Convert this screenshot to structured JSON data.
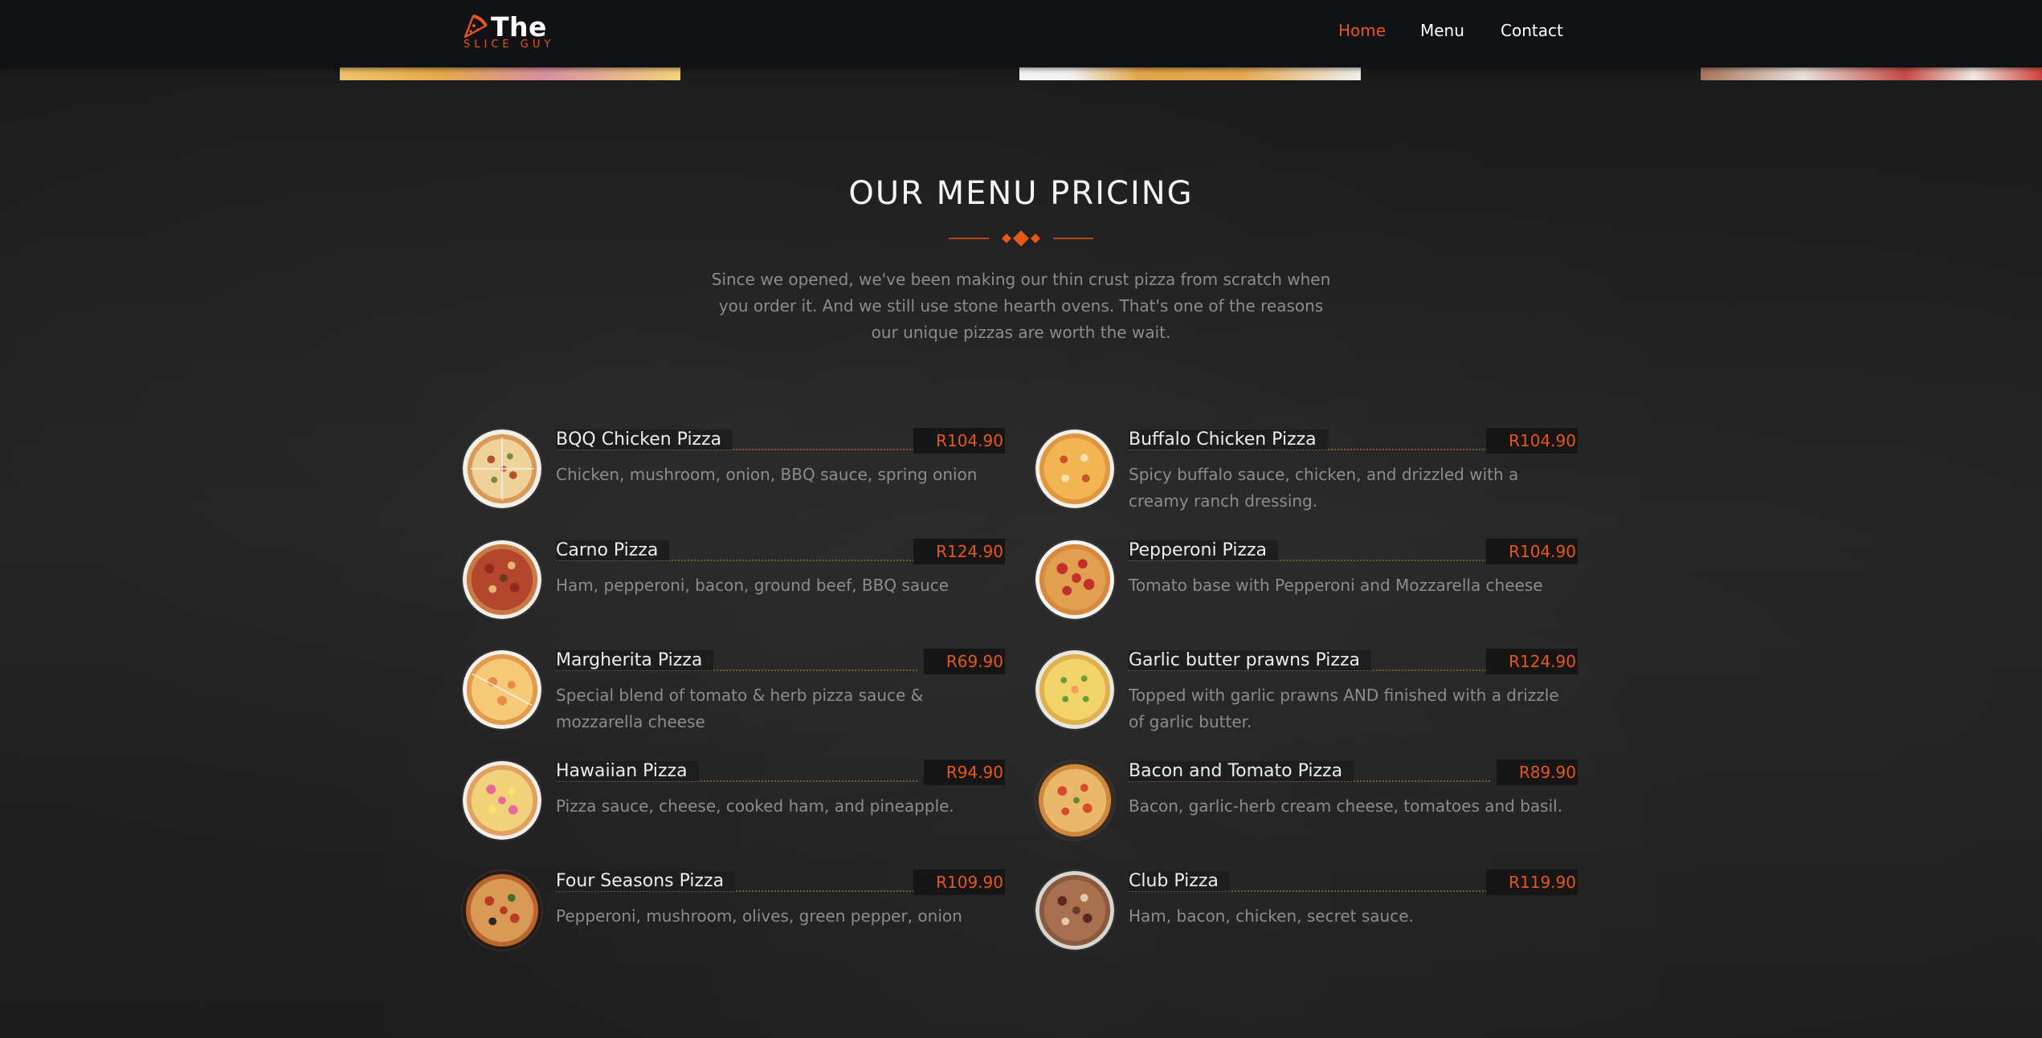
{
  "brand": {
    "name": "The",
    "tagline": "SLICE GUY",
    "accent": "#e8571a"
  },
  "nav": {
    "home": "Home",
    "menu": "Menu",
    "contact": "Contact",
    "active": "Home"
  },
  "section": {
    "title": "OUR MENU PRICING",
    "intro": "Since we opened, we've been making our thin crust pizza from scratch when you order it. And we still use stone hearth ovens. That's one of the reasons our unique pizzas are worth the wait."
  },
  "menu": {
    "left": [
      {
        "name": "BQQ Chicken Pizza",
        "price": "R104.90",
        "desc": "Chicken, mushroom, onion, BBQ sauce, spring onion"
      },
      {
        "name": "Carno Pizza",
        "price": "R124.90",
        "desc": "Ham, pepperoni, bacon, ground beef, BBQ sauce"
      },
      {
        "name": "Margherita Pizza",
        "price": "R69.90",
        "desc": "Special blend of tomato & herb pizza sauce & mozzarella cheese"
      },
      {
        "name": "Hawaiian Pizza",
        "price": "R94.90",
        "desc": "Pizza sauce, cheese, cooked ham, and pineapple."
      },
      {
        "name": "Four Seasons Pizza",
        "price": "R109.90",
        "desc": "Pepperoni, mushroom, olives, green pepper, onion"
      }
    ],
    "right": [
      {
        "name": "Buffalo Chicken Pizza",
        "price": "R104.90",
        "desc": "Spicy buffalo sauce, chicken, and drizzled with a creamy ranch dressing."
      },
      {
        "name": "Pepperoni Pizza",
        "price": "R104.90",
        "desc": "Tomato base with Pepperoni and Mozzarella cheese"
      },
      {
        "name": "Garlic butter prawns Pizza",
        "price": "R124.90",
        "desc": "Topped with garlic prawns AND finished with a drizzle of garlic butter."
      },
      {
        "name": "Bacon and Tomato Pizza",
        "price": "R89.90",
        "desc": "Bacon, garlic-herb cream cheese, tomatoes and basil."
      },
      {
        "name": "Club Pizza",
        "price": "R119.90",
        "desc": "Ham, bacon, chicken, secret sauce."
      }
    ]
  },
  "icons": {
    "logo": "pizza-slice-icon",
    "divider": "diamond-divider"
  }
}
